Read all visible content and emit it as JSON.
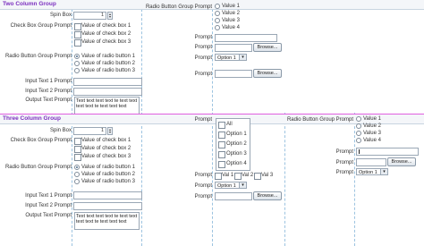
{
  "sections": {
    "two_col": {
      "title": "Two Column Group"
    },
    "three_col": {
      "title": "Three Column Group"
    }
  },
  "labels": {
    "spin_box": "Spin Box",
    "check_box_group": "Check Box Group Prompt",
    "radio_button_group": "Radio Button Group Prompt",
    "input_text_1": "Input Text 1 Prompt",
    "input_text_2": "Input Text 2 Prompt",
    "output_text": "Output Text Prompt",
    "prompt": "Prompt"
  },
  "spin_value": "1",
  "checkboxes": [
    "Value of check box 1",
    "Value of check box 2",
    "Value of check box 3"
  ],
  "radios": [
    "Value of radio button 1",
    "Value of radio button 2",
    "Value of radio button 3"
  ],
  "values": [
    "Value 1",
    "Value 2",
    "Value 3",
    "Value 4"
  ],
  "output_text": "Text text text text te text text text text te text text text",
  "browse": "Browse...",
  "select_value": "Option 1",
  "listbox": [
    "All",
    "Option 1",
    "Option 2",
    "Option 3",
    "Option 4"
  ],
  "inline_checks": [
    "Val 1",
    "Val 2",
    "Val 3"
  ]
}
